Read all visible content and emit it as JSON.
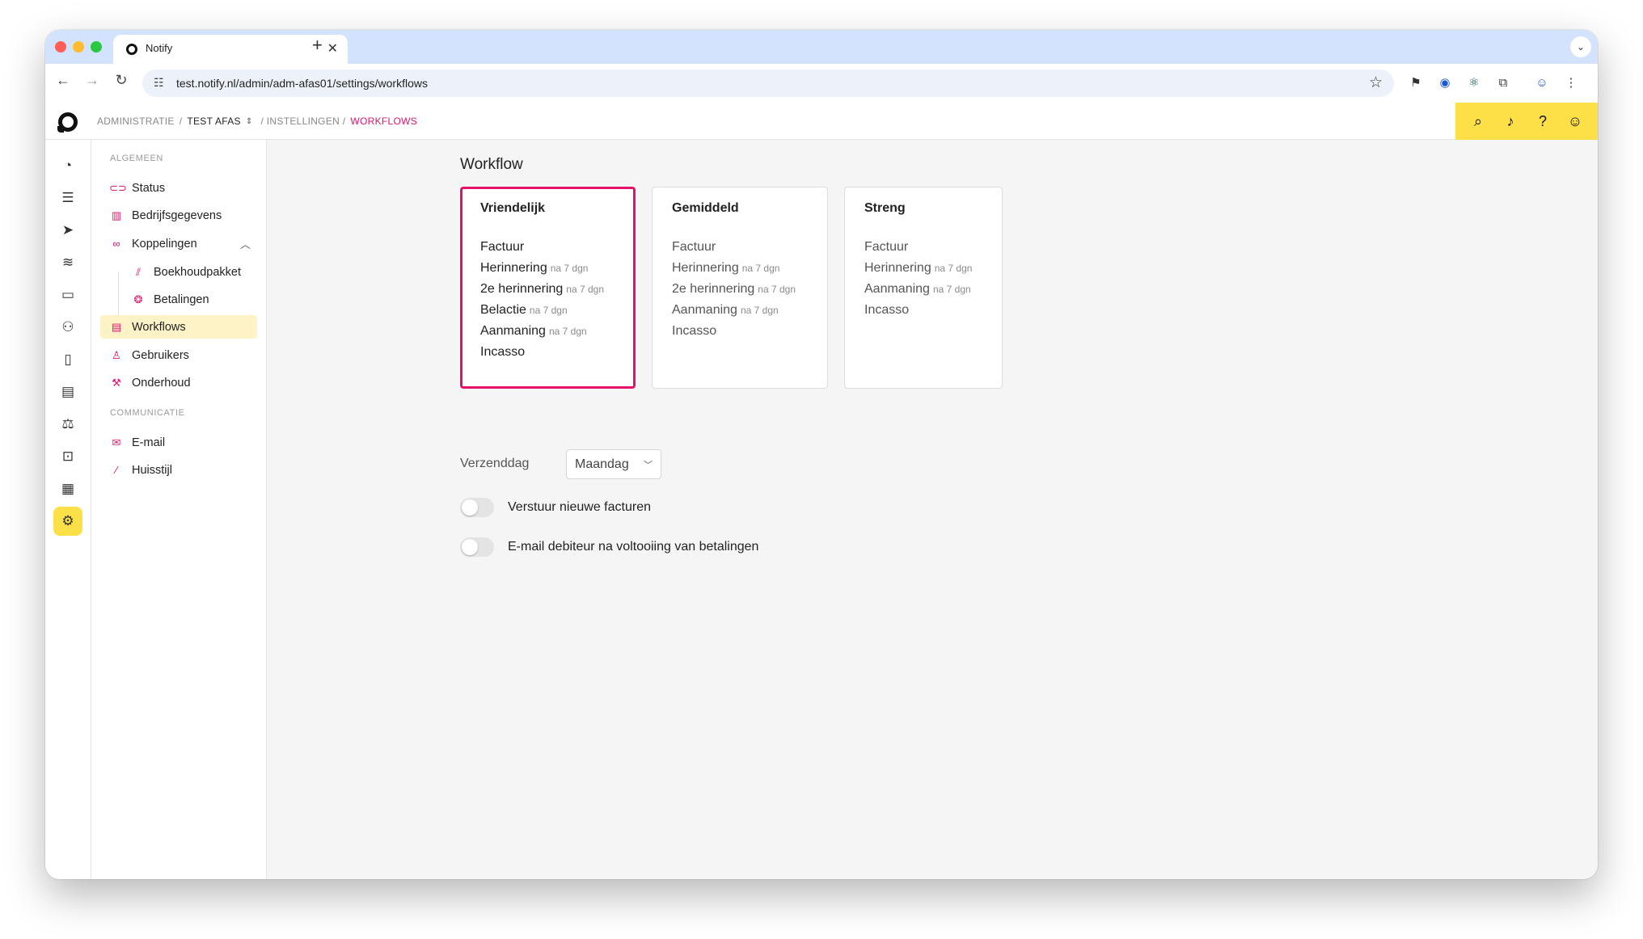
{
  "browser": {
    "tab_title": "Notify",
    "tab_close": "✕",
    "new_tab": "+",
    "tab_menu": "⌄",
    "url": "test.notify.nl/admin/adm-afas01/settings/workflows",
    "icons": [
      "back-arrow-icon",
      "forward-arrow-icon",
      "reload-icon",
      "site-settings-icon",
      "bookmark-star-icon",
      "extension-icon",
      "password-manager-icon",
      "react-devtools-icon",
      "extensions-puzzle-icon",
      "profile-icon",
      "menu-dots-icon"
    ]
  },
  "breadcrumb": {
    "items": [
      "ADMINISTRATIE",
      "/",
      "TEST AFAS",
      "/ INSTELLINGEN /",
      "WORKFLOWS"
    ]
  },
  "header_actions": [
    "search-icon",
    "notifications-icon",
    "help-icon",
    "user-icon"
  ],
  "rail": {
    "icons": [
      "dashboard-icon",
      "tasks-icon",
      "send-icon",
      "handshake-icon",
      "message-alert-icon",
      "users-icon",
      "document-icon",
      "card-icon",
      "scale-icon",
      "inbox-icon",
      "clipboard-icon",
      "settings-icon"
    ],
    "active": "settings-icon"
  },
  "sidebar": {
    "section_general": "ALGEMEEN",
    "section_communication": "COMMUNICATIE",
    "items": [
      {
        "label": "Status",
        "icon": "toggle-icon"
      },
      {
        "label": "Bedrijfsgegevens",
        "icon": "building-icon"
      },
      {
        "label": "Koppelingen",
        "icon": "link-icon"
      },
      {
        "label": "Boekhoudpakket",
        "icon": "chart-icon"
      },
      {
        "label": "Betalingen",
        "icon": "coins-icon"
      },
      {
        "label": "Workflows",
        "icon": "clipboard-icon"
      },
      {
        "label": "Gebruikers",
        "icon": "user-icon"
      },
      {
        "label": "Onderhoud",
        "icon": "wrench-icon"
      },
      {
        "label": "E-mail",
        "icon": "mail-icon"
      },
      {
        "label": "Huisstijl",
        "icon": "magic-wand-icon"
      }
    ],
    "active": "Workflows"
  },
  "main": {
    "title": "Workflow",
    "cards": [
      {
        "title": "Vriendelijk",
        "selected": true,
        "steps": [
          {
            "name": "Factuur",
            "delay": ""
          },
          {
            "name": "Herinnering",
            "delay": "na 7 dgn"
          },
          {
            "name": "2e herinnering",
            "delay": "na 7 dgn"
          },
          {
            "name": "Belactie",
            "delay": "na 7 dgn"
          },
          {
            "name": "Aanmaning",
            "delay": "na 7 dgn"
          },
          {
            "name": "Incasso",
            "delay": ""
          }
        ]
      },
      {
        "title": "Gemiddeld",
        "selected": false,
        "steps": [
          {
            "name": "Factuur",
            "delay": ""
          },
          {
            "name": "Herinnering",
            "delay": "na 7 dgn"
          },
          {
            "name": "2e herinnering",
            "delay": "na 7 dgn"
          },
          {
            "name": "Aanmaning",
            "delay": "na 7 dgn"
          },
          {
            "name": "Incasso",
            "delay": ""
          }
        ]
      },
      {
        "title": "Streng",
        "selected": false,
        "steps": [
          {
            "name": "Factuur",
            "delay": ""
          },
          {
            "name": "Herinnering",
            "delay": "na 7 dgn"
          },
          {
            "name": "Aanmaning",
            "delay": "na 7 dgn"
          },
          {
            "name": "Incasso",
            "delay": ""
          }
        ]
      }
    ],
    "send_day_label": "Verzenddag",
    "send_day_value": "Maandag",
    "toggles": [
      {
        "label": "Verstuur nieuwe facturen",
        "on": false
      },
      {
        "label": "E-mail debiteur na voltooiing van betalingen",
        "on": false
      }
    ]
  },
  "colors": {
    "accent_pink": "#e4126b",
    "accent_yellow": "#fde047",
    "active_nav_bg": "#fef3c7"
  }
}
